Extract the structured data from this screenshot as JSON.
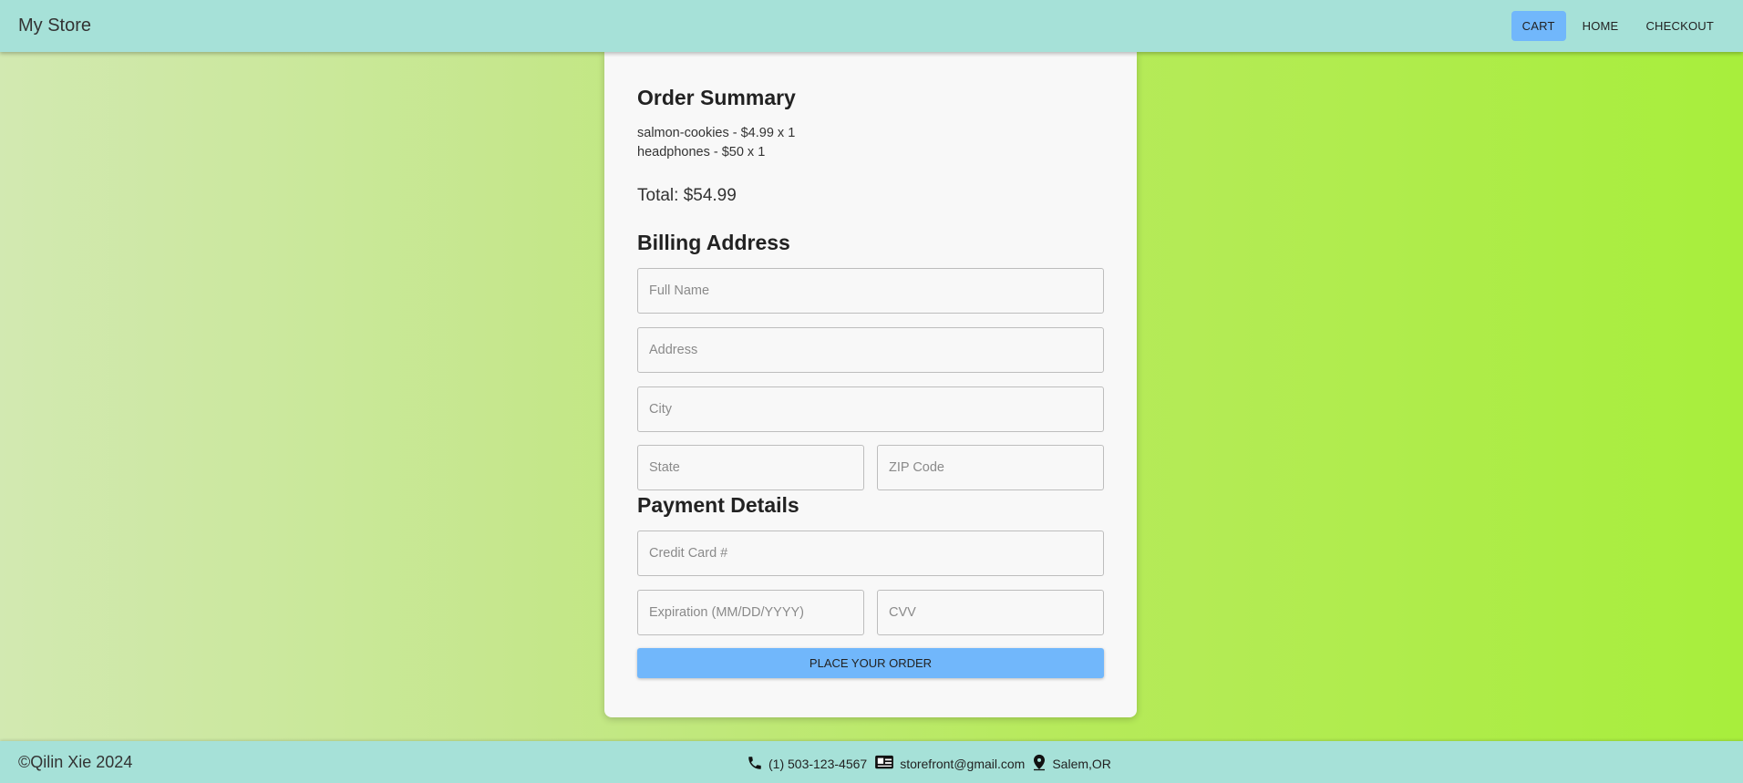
{
  "header": {
    "brand": "My Store",
    "nav": [
      {
        "label": "Cart",
        "active": true
      },
      {
        "label": "Home",
        "active": false
      },
      {
        "label": "Checkout",
        "active": false
      }
    ]
  },
  "order_summary": {
    "title": "Order Summary",
    "items": [
      "salmon-cookies - $4.99 x 1",
      "headphones - $50 x 1"
    ],
    "total": "Total: $54.99"
  },
  "billing": {
    "title": "Billing Address",
    "full_name_placeholder": "Full Name",
    "address_placeholder": "Address",
    "city_placeholder": "City",
    "state_placeholder": "State",
    "zip_placeholder": "ZIP Code"
  },
  "payment": {
    "title": "Payment Details",
    "card_placeholder": "Credit Card #",
    "expiration_placeholder": "Expiration (MM/DD/YYYY)",
    "cvv_placeholder": "CVV",
    "submit_label": "Place Your Order"
  },
  "footer": {
    "copyright": "©Qilin Xie 2024",
    "phone": "(1) 503-123-4567",
    "email": "storefront@gmail.com",
    "location": "Salem,OR"
  },
  "colors": {
    "header_bg": "#a6e1d8",
    "accent_button": "#71b7fb",
    "card_bg": "#f8f8f8"
  }
}
